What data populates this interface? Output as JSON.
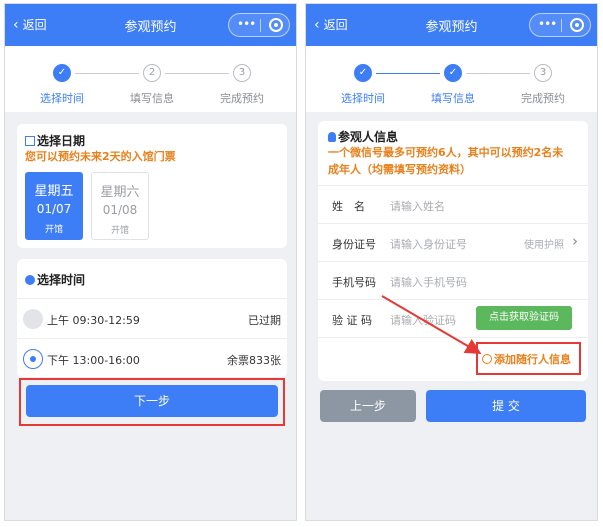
{
  "common": {
    "back_label": "返回",
    "title": "参观预约",
    "capsule_dots": "•••"
  },
  "steps": [
    "选择时间",
    "填写信息",
    "完成预约"
  ],
  "step_numbers": [
    "2",
    "3"
  ],
  "left": {
    "date_card_title": "选择日期",
    "date_notice": "您可以预约未来2天的入馆门票",
    "dates": [
      {
        "weekday": "星期五",
        "date": "01/07",
        "status": "开馆"
      },
      {
        "weekday": "星期六",
        "date": "01/08",
        "status": "开馆"
      }
    ],
    "time_card_title": "选择时间",
    "slots": [
      {
        "time": "上午 09:30-12:59",
        "status": "已过期"
      },
      {
        "time": "下午 13:00-16:00",
        "status": "余票833张"
      }
    ],
    "next_button": "下一步"
  },
  "right": {
    "visitor_card_title": "参观人信息",
    "notice_line1": "一个微信号最多可预约6人，其中可以预约2名未",
    "notice_line2": "成年人（均需填写预约资料）",
    "fields": [
      {
        "label": "姓　名",
        "placeholder": "请输入姓名"
      },
      {
        "label": "身份证号",
        "placeholder": "请输入身份证号"
      },
      {
        "label": "手机号码",
        "placeholder": "请输入手机号码"
      },
      {
        "label": "验 证 码",
        "placeholder": "请输入验证码"
      }
    ],
    "passport_link": "使用护照",
    "get_code_button": "点击获取验证码",
    "add_companion": "添加随行人信息",
    "prev_button": "上一步",
    "submit_button": "提 交"
  },
  "colors": {
    "primary": "#3d7ef6",
    "warning": "#e8801c",
    "highlight": "#e53935",
    "code_button": "#5cb85c",
    "prev_button": "#8d97a3"
  }
}
